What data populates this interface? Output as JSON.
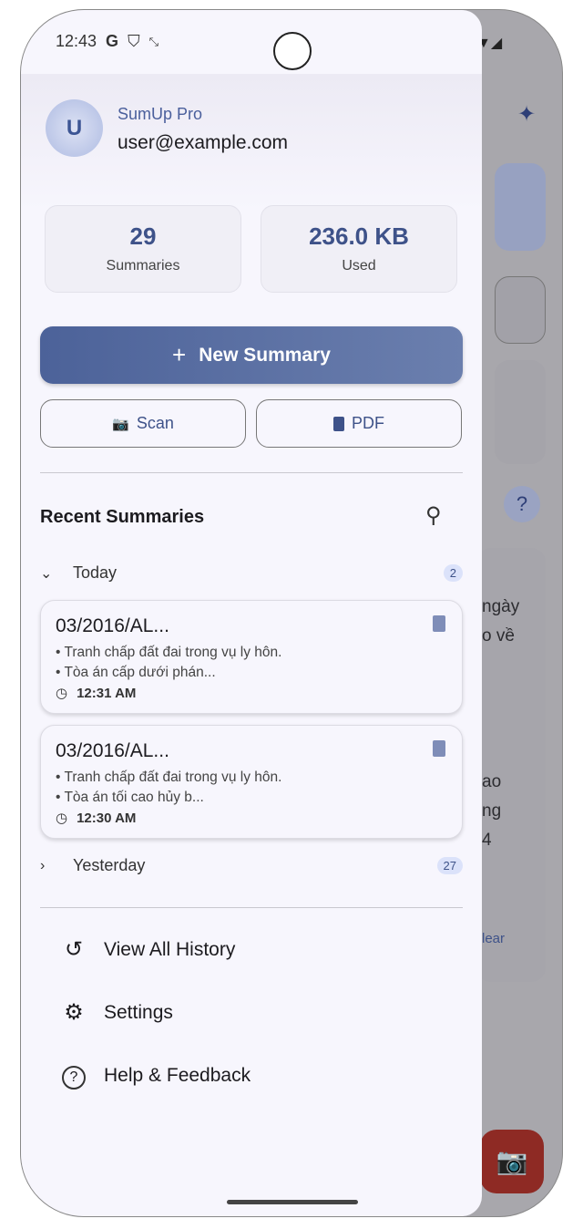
{
  "status": {
    "time": "12:43",
    "icons": [
      "google-icon",
      "shield-icon",
      "sync-icon"
    ]
  },
  "profile": {
    "initial": "U",
    "app_name": "SumUp Pro",
    "email": "user@example.com"
  },
  "stats": [
    {
      "value": "29",
      "label": "Summaries"
    },
    {
      "value": "236.0 KB",
      "label": "Used"
    }
  ],
  "actions": {
    "new_summary": "New Summary",
    "scan": "Scan",
    "pdf": "PDF"
  },
  "recent": {
    "title": "Recent Summaries",
    "groups": [
      {
        "label": "Today",
        "count": "2"
      },
      {
        "label": "Yesterday",
        "count": "27"
      }
    ],
    "items": [
      {
        "title": "03/2016/AL...",
        "line1": "• Tranh chấp đất đai trong vụ ly hôn.",
        "line2": "• Tòa án cấp dưới phán...",
        "time": "12:31 AM"
      },
      {
        "title": "03/2016/AL...",
        "line1": "• Tranh chấp đất đai trong vụ ly hôn.",
        "line2": "• Tòa án tối cao hủy b...",
        "time": "12:30 AM"
      }
    ]
  },
  "menu": [
    {
      "label": "View All History"
    },
    {
      "label": "Settings"
    },
    {
      "label": "Help & Feedback"
    }
  ],
  "background": {
    "t1": "ngày",
    "t2": "o về",
    "t3": "ao",
    "t4": "ng",
    "t5": "4",
    "clear": "lear"
  }
}
